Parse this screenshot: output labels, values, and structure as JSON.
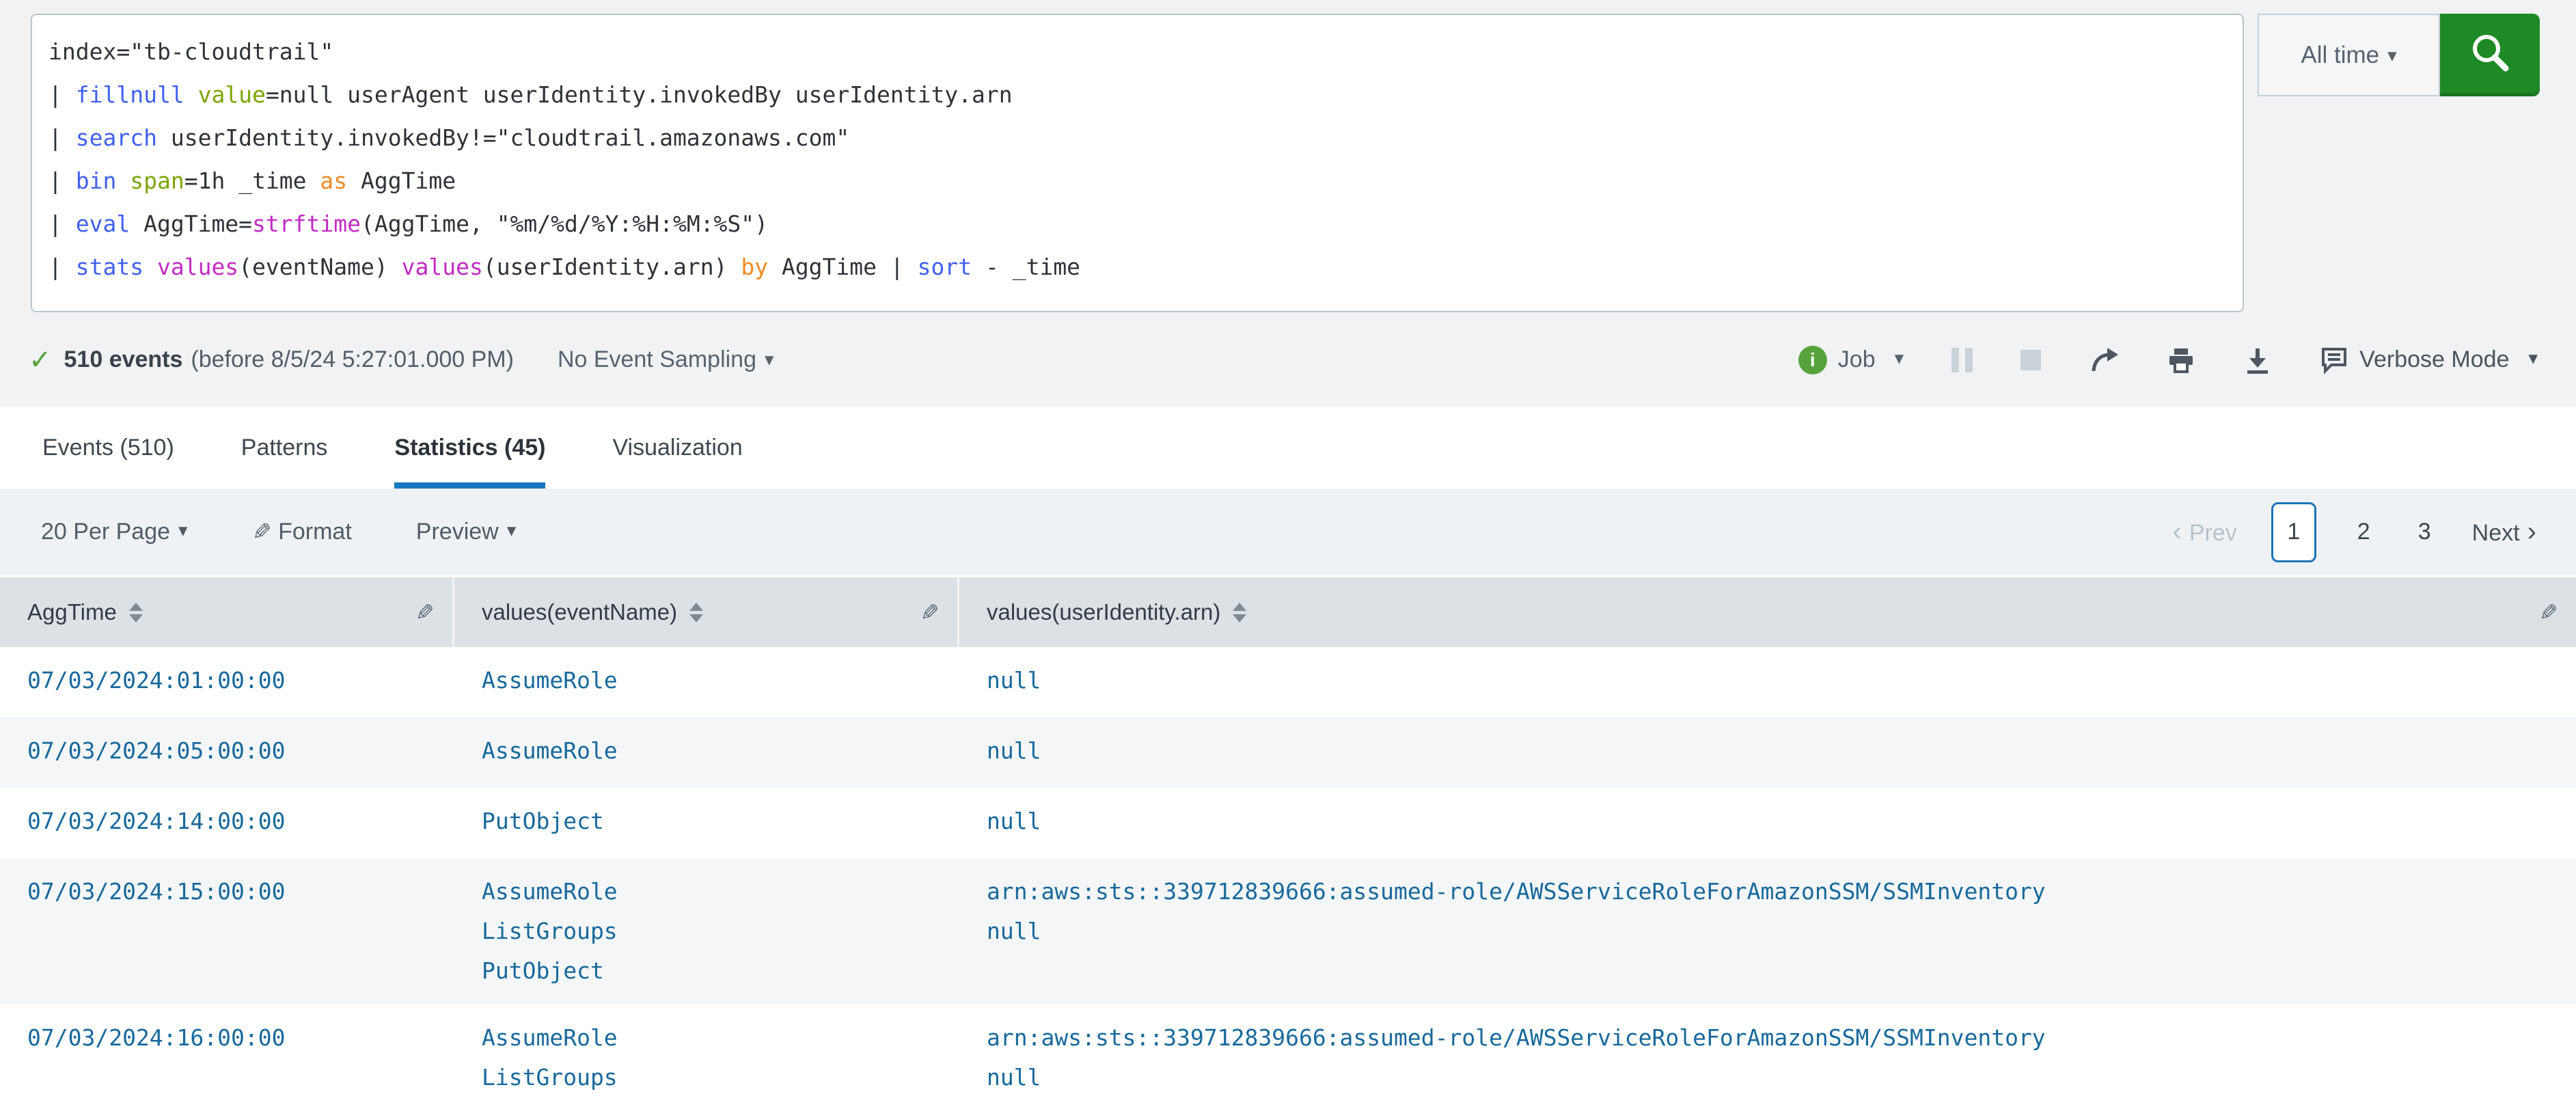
{
  "colors": {
    "accent_green_button": "#1e8a25",
    "success_green": "#57a33b",
    "active_tab_underline": "#1577c0",
    "current_page_border": "#1b74b8",
    "table_value_blue": "#17699c",
    "syntax_command_blue": "#4060ee",
    "syntax_modifier_green": "#7ca500",
    "syntax_keyword_orange": "#ee8b23",
    "syntax_function_magenta": "#c32ac3",
    "header_gray": "#dce1e6",
    "alt_row_gray": "#f4f6f7"
  },
  "icons": {
    "search_button": "magnifier-icon",
    "time_caret": "caret-down",
    "result_check": "checkmark",
    "job_info": "info-circle-green",
    "pause": "double-vertical-bars",
    "stop": "square",
    "share": "curved-arrow-right",
    "print": "printer",
    "export": "download-arrow",
    "verbose": "speech-bubble-lines",
    "format": "paintbrush",
    "column_sort": "up-down-triangles",
    "column_edit": "paintbrush"
  },
  "search": {
    "time_range_label": "All time",
    "query_lines": [
      [
        {
          "c": "plain",
          "t": "index=\"tb-cloudtrail\""
        }
      ],
      [
        {
          "c": "plain",
          "t": "| "
        },
        {
          "c": "command",
          "t": "fillnull"
        },
        {
          "c": "plain",
          "t": " "
        },
        {
          "c": "modifier",
          "t": "value"
        },
        {
          "c": "plain",
          "t": "=null userAgent userIdentity.invokedBy userIdentity.arn"
        }
      ],
      [
        {
          "c": "plain",
          "t": "| "
        },
        {
          "c": "command",
          "t": "search"
        },
        {
          "c": "plain",
          "t": " userIdentity.invokedBy!=\"cloudtrail.amazonaws.com\""
        }
      ],
      [
        {
          "c": "plain",
          "t": "| "
        },
        {
          "c": "command",
          "t": "bin"
        },
        {
          "c": "plain",
          "t": " "
        },
        {
          "c": "modifier",
          "t": "span"
        },
        {
          "c": "plain",
          "t": "=1h _time "
        },
        {
          "c": "keyword",
          "t": "as"
        },
        {
          "c": "plain",
          "t": " AggTime"
        }
      ],
      [
        {
          "c": "plain",
          "t": "| "
        },
        {
          "c": "command",
          "t": "eval"
        },
        {
          "c": "plain",
          "t": " AggTime="
        },
        {
          "c": "function",
          "t": "strftime"
        },
        {
          "c": "plain",
          "t": "(AggTime, \"%m/%d/%Y:%H:%M:%S\")"
        }
      ],
      [
        {
          "c": "plain",
          "t": "| "
        },
        {
          "c": "command",
          "t": "stats"
        },
        {
          "c": "plain",
          "t": " "
        },
        {
          "c": "function",
          "t": "values"
        },
        {
          "c": "plain",
          "t": "(eventName) "
        },
        {
          "c": "function",
          "t": "values"
        },
        {
          "c": "plain",
          "t": "(userIdentity.arn) "
        },
        {
          "c": "keyword",
          "t": "by"
        },
        {
          "c": "plain",
          "t": " AggTime | "
        },
        {
          "c": "command",
          "t": "sort"
        },
        {
          "c": "plain",
          "t": " - _time"
        }
      ]
    ]
  },
  "results_bar": {
    "event_count": "510 events",
    "event_count_detail": "(before 8/5/24 5:27:01.000 PM)",
    "sampling_label": "No Event Sampling",
    "job_label": "Job",
    "verbose_label": "Verbose Mode"
  },
  "tabs": [
    {
      "label": "Events (510)",
      "active": false
    },
    {
      "label": "Patterns",
      "active": false
    },
    {
      "label": "Statistics (45)",
      "active": true
    },
    {
      "label": "Visualization",
      "active": false
    }
  ],
  "toolbar": {
    "per_page_label": "20 Per Page",
    "format_label": "Format",
    "preview_label": "Preview"
  },
  "pagination": {
    "prev_label": "Prev",
    "next_label": "Next",
    "pages": [
      "1",
      "2",
      "3"
    ],
    "current_page": "1"
  },
  "table": {
    "columns": [
      "AggTime",
      "values(eventName)",
      "values(userIdentity.arn)"
    ],
    "rows": [
      {
        "aggtime": "07/03/2024:01:00:00",
        "event_names": [
          "AssumeRole"
        ],
        "arns": [
          "null"
        ]
      },
      {
        "aggtime": "07/03/2024:05:00:00",
        "event_names": [
          "AssumeRole"
        ],
        "arns": [
          "null"
        ]
      },
      {
        "aggtime": "07/03/2024:14:00:00",
        "event_names": [
          "PutObject"
        ],
        "arns": [
          "null"
        ]
      },
      {
        "aggtime": "07/03/2024:15:00:00",
        "event_names": [
          "AssumeRole",
          "ListGroups",
          "PutObject"
        ],
        "arns": [
          "arn:aws:sts::339712839666:assumed-role/AWSServiceRoleForAmazonSSM/SSMInventory",
          "null"
        ]
      },
      {
        "aggtime": "07/03/2024:16:00:00",
        "event_names": [
          "AssumeRole",
          "ListGroups"
        ],
        "arns": [
          "arn:aws:sts::339712839666:assumed-role/AWSServiceRoleForAmazonSSM/SSMInventory",
          "null"
        ]
      }
    ]
  }
}
